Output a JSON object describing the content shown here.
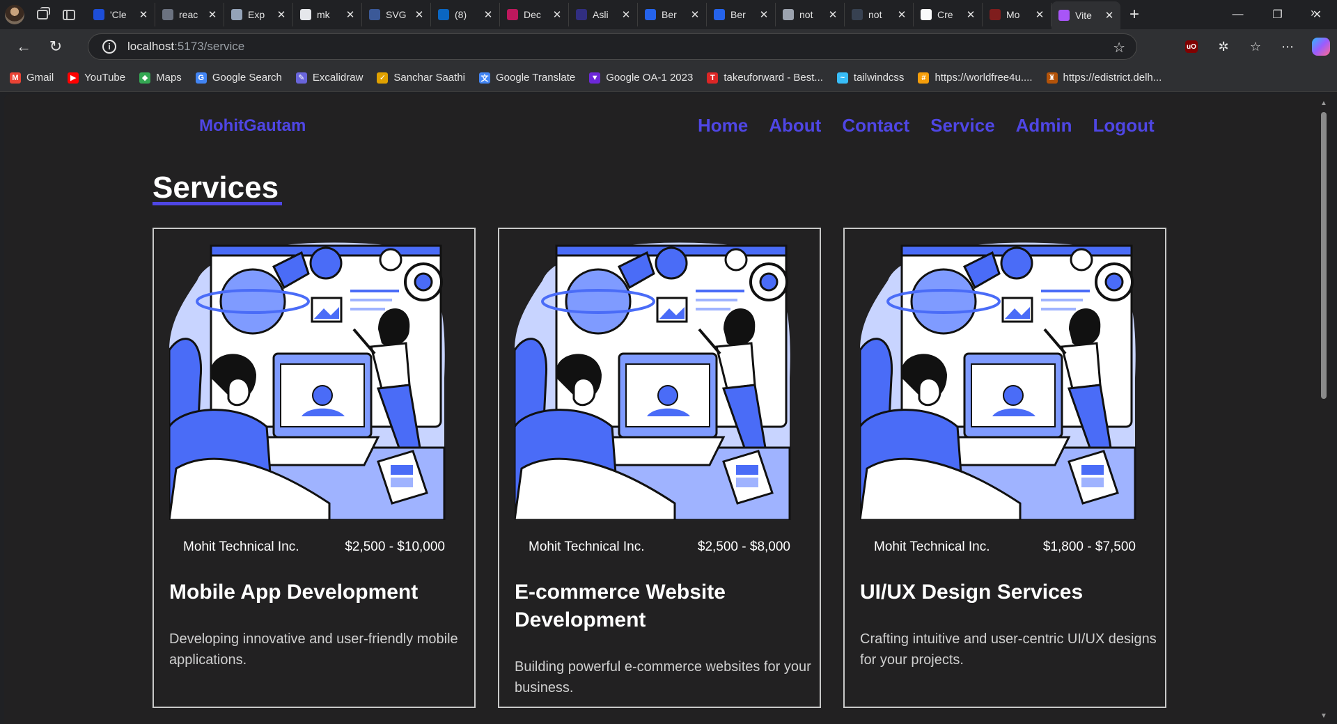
{
  "browser": {
    "tabs": [
      {
        "title": "'Cle",
        "color": "#1d4ed8"
      },
      {
        "title": "reac",
        "color": "#6b7280"
      },
      {
        "title": "Exp",
        "color": "#94a3b8"
      },
      {
        "title": "mk",
        "color": "#e5e7eb"
      },
      {
        "title": "SVG",
        "color": "#3b5998"
      },
      {
        "title": "(8)",
        "color": "#0a66c2"
      },
      {
        "title": "Dec",
        "color": "#be185d"
      },
      {
        "title": "Asli",
        "color": "#312e81"
      },
      {
        "title": "Ber",
        "color": "#2563eb"
      },
      {
        "title": "Ber",
        "color": "#2563eb"
      },
      {
        "title": "not",
        "color": "#9ca3af"
      },
      {
        "title": "not",
        "color": "#374151"
      },
      {
        "title": "Cre",
        "color": "#f9fafb"
      },
      {
        "title": "Mo",
        "color": "#7f1d1d"
      },
      {
        "title": "Vite",
        "color": "#a855f7"
      }
    ],
    "url_host": "localhost",
    "url_path": ":5173/service",
    "bookmarks": [
      {
        "label": "Gmail",
        "color": "#ea4335",
        "glyph": "M"
      },
      {
        "label": "YouTube",
        "color": "#ff0000",
        "glyph": "▶"
      },
      {
        "label": "Maps",
        "color": "#34a853",
        "glyph": "◆"
      },
      {
        "label": "Google Search",
        "color": "#4285f4",
        "glyph": "G"
      },
      {
        "label": "Excalidraw",
        "color": "#6965db",
        "glyph": "✎"
      },
      {
        "label": "Sanchar Saathi",
        "color": "#e0a100",
        "glyph": "✓"
      },
      {
        "label": "Google Translate",
        "color": "#4285f4",
        "glyph": "文"
      },
      {
        "label": "Google OA-1 2023",
        "color": "#6d28d9",
        "glyph": "▼"
      },
      {
        "label": "takeuforward - Best...",
        "color": "#dc2626",
        "glyph": "T"
      },
      {
        "label": "tailwindcss",
        "color": "#38bdf8",
        "glyph": "~"
      },
      {
        "label": "https://worldfree4u....",
        "color": "#f59e0b",
        "glyph": "#"
      },
      {
        "label": "https://edistrict.delh...",
        "color": "#b45309",
        "glyph": "♜"
      }
    ]
  },
  "site": {
    "brand": "MohitGautam",
    "nav": [
      "Home",
      "About",
      "Contact",
      "Service",
      "Admin",
      "Logout"
    ],
    "accent": "#4f46e5",
    "section_title": "Services",
    "cards": [
      {
        "company": "Mohit Technical Inc.",
        "price": "$2,500 - $10,000",
        "title": "Mobile App Development",
        "description": "Developing innovative and user-friendly mobile applications."
      },
      {
        "company": "Mohit Technical Inc.",
        "price": "$2,500 - $8,000",
        "title": "E-commerce Website Development",
        "description": "Building powerful e-commerce websites for your business."
      },
      {
        "company": "Mohit Technical Inc.",
        "price": "$1,800 - $7,500",
        "title": "UI/UX Design Services",
        "description": "Crafting intuitive and user-centric UI/UX designs for your projects."
      }
    ]
  }
}
